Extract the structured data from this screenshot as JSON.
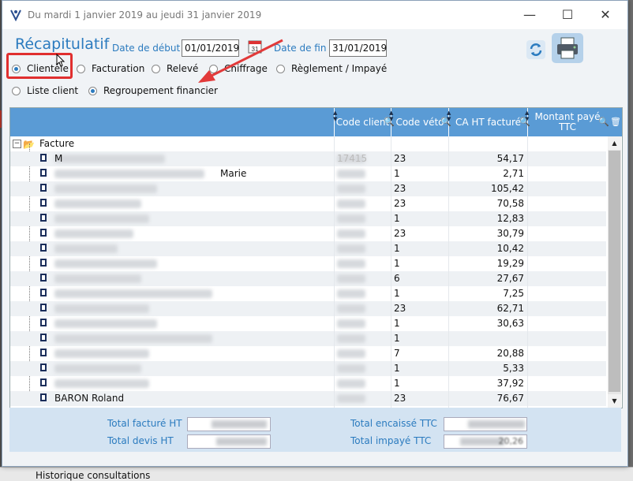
{
  "window": {
    "title": "Du mardi 1 janvier 2019 au jeudi 31 janvier 2019",
    "minimize": "—",
    "maximize": "☐",
    "close": "✕"
  },
  "header": {
    "page_title": "Récapitulatif",
    "start_label": "Date de début",
    "start_value": "01/01/2019",
    "calendar_day": "31",
    "end_label": "Date de fin",
    "end_value": "31/01/2019"
  },
  "view_options": [
    {
      "label": "Clientèle",
      "selected": true
    },
    {
      "label": "Facturation",
      "selected": false
    },
    {
      "label": "Relevé",
      "selected": false
    },
    {
      "label": "Chiffrage",
      "selected": false
    },
    {
      "label": "Règlement / Impayé",
      "selected": false
    }
  ],
  "display_options": [
    {
      "label": "Liste client",
      "selected": false
    },
    {
      "label": "Regroupement financier",
      "selected": true
    }
  ],
  "table": {
    "columns": [
      "",
      "Code client",
      "Code véto",
      "CA HT facturé",
      "Montant payé TTC"
    ],
    "group_label": "Facture",
    "rows": [
      {
        "name": "M",
        "code_client": "17415",
        "code_veto": "23",
        "ca": "54,17"
      },
      {
        "name": "Marie",
        "code_client": "",
        "code_veto": "1",
        "ca": "2,71"
      },
      {
        "name": "",
        "code_client": "",
        "code_veto": "23",
        "ca": "105,42"
      },
      {
        "name": "",
        "code_client": "",
        "code_veto": "23",
        "ca": "70,58"
      },
      {
        "name": "",
        "code_client": "",
        "code_veto": "1",
        "ca": "12,83"
      },
      {
        "name": "",
        "code_client": "",
        "code_veto": "23",
        "ca": "30,79"
      },
      {
        "name": "",
        "code_client": "",
        "code_veto": "1",
        "ca": "10,42"
      },
      {
        "name": "",
        "code_client": "",
        "code_veto": "1",
        "ca": "19,29"
      },
      {
        "name": "",
        "code_client": "",
        "code_veto": "6",
        "ca": "27,67"
      },
      {
        "name": "",
        "code_client": "",
        "code_veto": "1",
        "ca": "7,25"
      },
      {
        "name": "",
        "code_client": "",
        "code_veto": "23",
        "ca": "62,71"
      },
      {
        "name": "",
        "code_client": "",
        "code_veto": "1",
        "ca": "30,63"
      },
      {
        "name": "",
        "code_client": "",
        "code_veto": "1",
        "ca": ""
      },
      {
        "name": "",
        "code_client": "",
        "code_veto": "7",
        "ca": "20,88"
      },
      {
        "name": "",
        "code_client": "",
        "code_veto": "1",
        "ca": "5,33"
      },
      {
        "name": "",
        "code_client": "",
        "code_veto": "1",
        "ca": "37,92"
      },
      {
        "name": "BARON Roland",
        "code_client": "",
        "code_veto": "23",
        "ca": "76,67"
      }
    ]
  },
  "footer": {
    "total_facture_label": "Total facturé HT",
    "total_devis_label": "Total devis HT",
    "total_encaisse_label": "Total encaissé TTC",
    "total_impaye_label": "Total impayé TTC",
    "total_impaye_value": "20,26"
  },
  "background": {
    "bottom_text": "Historique consultations"
  },
  "colors": {
    "accent": "#2b7bbf",
    "header_bg": "#5a9bd5",
    "highlight": "#e02f2f"
  }
}
